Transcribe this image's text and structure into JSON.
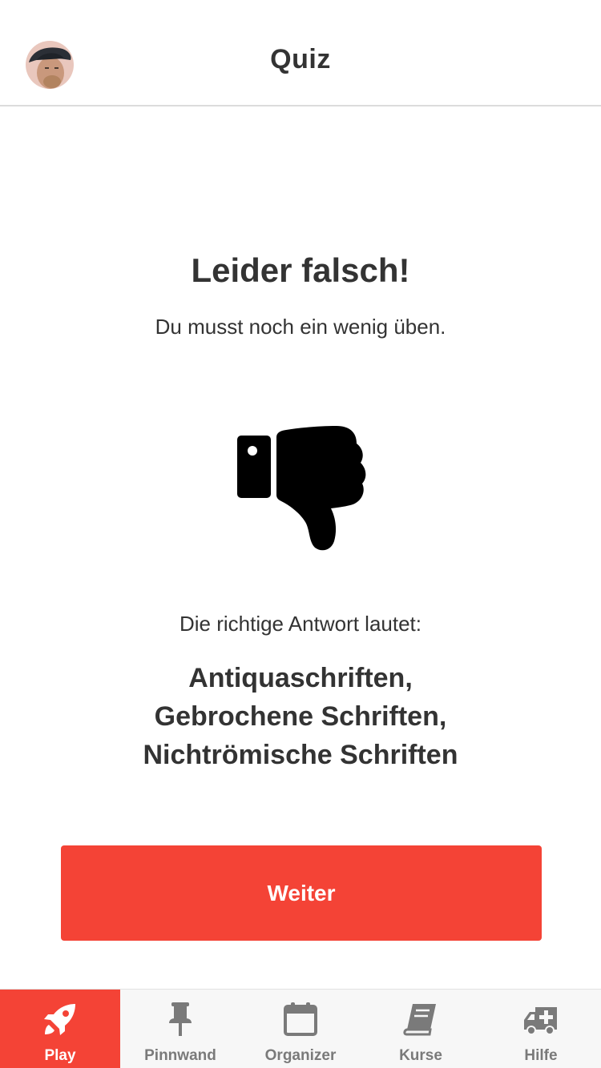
{
  "header": {
    "title": "Quiz"
  },
  "result": {
    "headline": "Leider falsch!",
    "message": "Du musst noch ein wenig üben."
  },
  "answer": {
    "label": "Die richtige Antwort lautet:",
    "lines": [
      "Antiquaschriften,",
      "Gebrochene Schriften,",
      "Nichtrömische Schriften"
    ]
  },
  "button": {
    "label": "Weiter"
  },
  "tabs": [
    {
      "label": "Play",
      "icon": "rocket-icon",
      "active": true
    },
    {
      "label": "Pinnwand",
      "icon": "pin-icon",
      "active": false
    },
    {
      "label": "Organizer",
      "icon": "calendar-icon",
      "active": false
    },
    {
      "label": "Kurse",
      "icon": "book-icon",
      "active": false
    },
    {
      "label": "Hilfe",
      "icon": "ambulance-icon",
      "active": false
    }
  ],
  "colors": {
    "accent": "#f44336",
    "text": "#333333",
    "tab_inactive": "#7a7a7a",
    "tabbar_bg": "#f7f7f7"
  }
}
